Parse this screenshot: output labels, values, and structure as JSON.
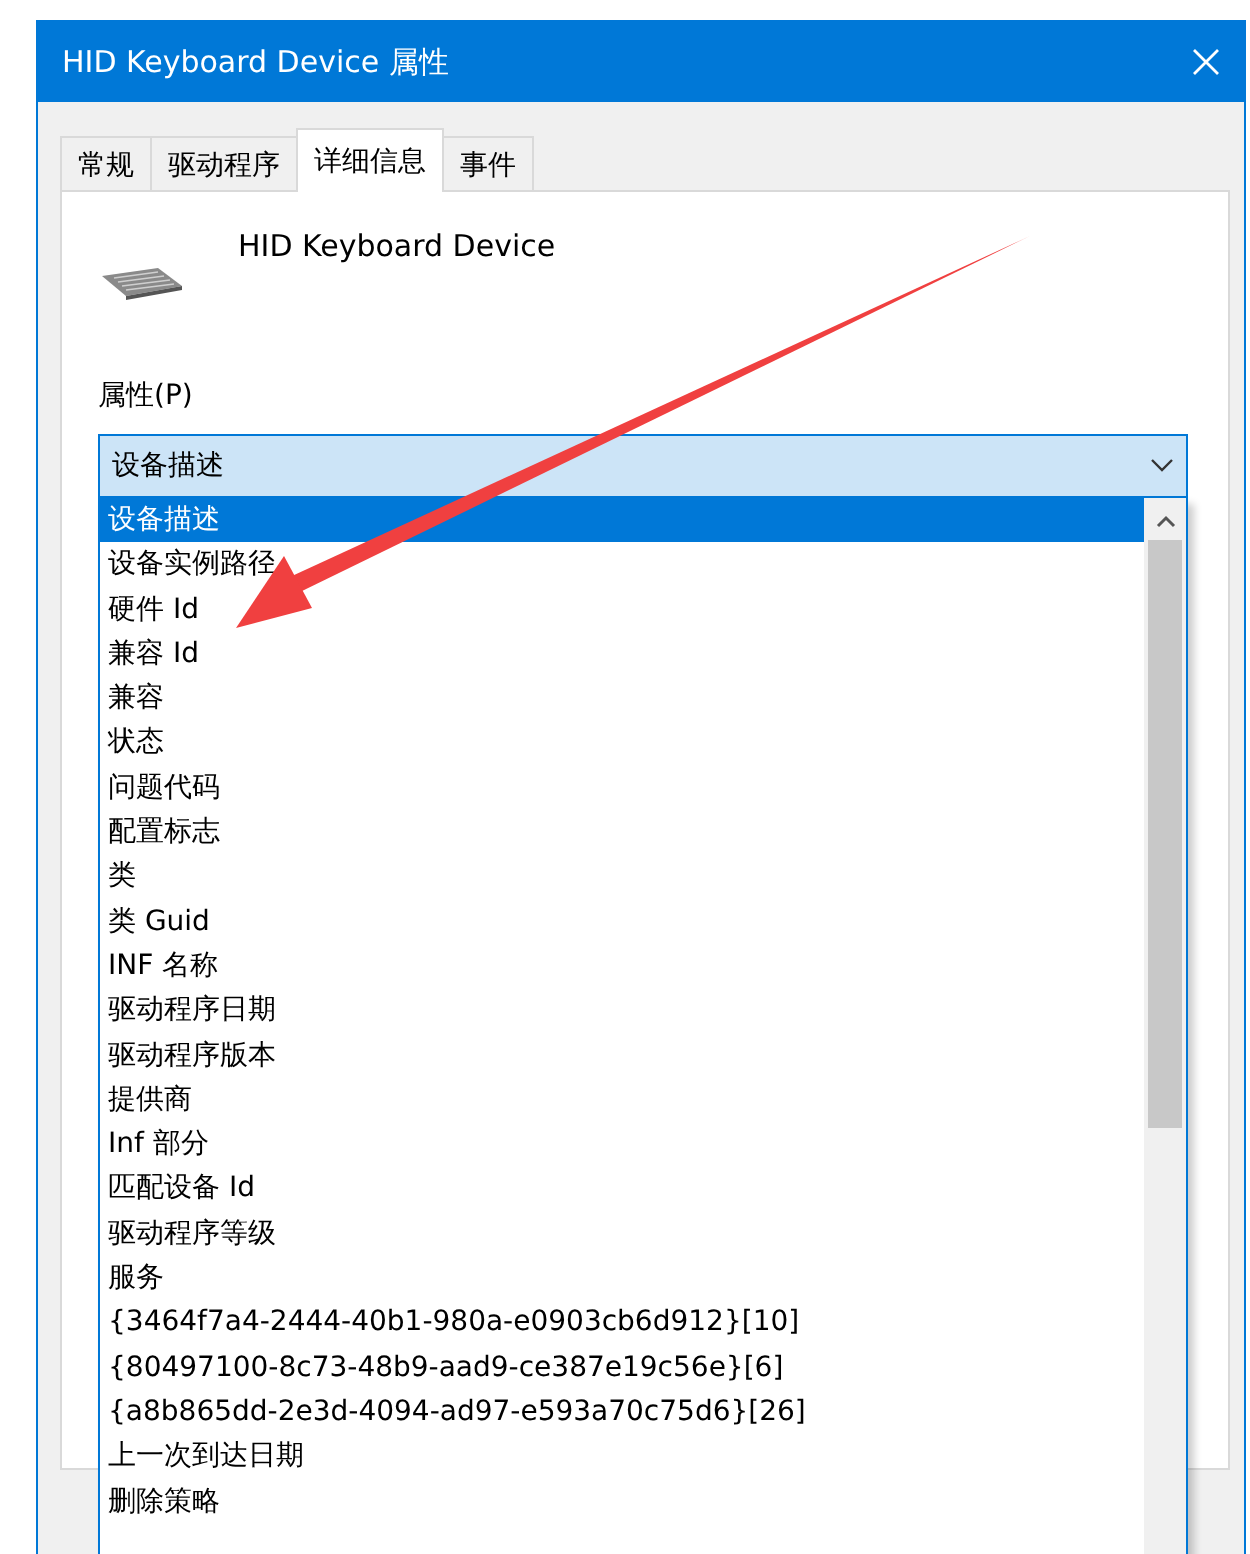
{
  "window": {
    "title": "HID Keyboard Device 属性"
  },
  "tabs": [
    {
      "label": "常规",
      "selected": false
    },
    {
      "label": "驱动程序",
      "selected": false
    },
    {
      "label": "详细信息",
      "selected": true
    },
    {
      "label": "事件",
      "selected": false
    }
  ],
  "device_name": "HID Keyboard Device",
  "property_label": "属性(P)",
  "property_dropdown": {
    "value": "设备描述",
    "expanded": true
  },
  "property_list": [
    {
      "label": "设备描述",
      "selected": true
    },
    {
      "label": "设备实例路径",
      "selected": false
    },
    {
      "label": "硬件 Id",
      "selected": false
    },
    {
      "label": "兼容 Id",
      "selected": false
    },
    {
      "label": "兼容",
      "selected": false
    },
    {
      "label": "状态",
      "selected": false
    },
    {
      "label": "问题代码",
      "selected": false
    },
    {
      "label": "配置标志",
      "selected": false
    },
    {
      "label": "类",
      "selected": false
    },
    {
      "label": "类 Guid",
      "selected": false
    },
    {
      "label": "INF 名称",
      "selected": false
    },
    {
      "label": "驱动程序日期",
      "selected": false
    },
    {
      "label": "驱动程序版本",
      "selected": false
    },
    {
      "label": "提供商",
      "selected": false
    },
    {
      "label": "Inf 部分",
      "selected": false
    },
    {
      "label": "匹配设备 Id",
      "selected": false
    },
    {
      "label": "驱动程序等级",
      "selected": false
    },
    {
      "label": "服务",
      "selected": false
    },
    {
      "label": "{3464f7a4-2444-40b1-980a-e0903cb6d912}[10]",
      "selected": false
    },
    {
      "label": "{80497100-8c73-48b9-aad9-ce387e19c56e}[6]",
      "selected": false
    },
    {
      "label": "{a8b865dd-2e3d-4094-ad97-e593a70c75d6}[26]",
      "selected": false
    },
    {
      "label": "上一次到达日期",
      "selected": false
    },
    {
      "label": "删除策略",
      "selected": false
    }
  ]
}
